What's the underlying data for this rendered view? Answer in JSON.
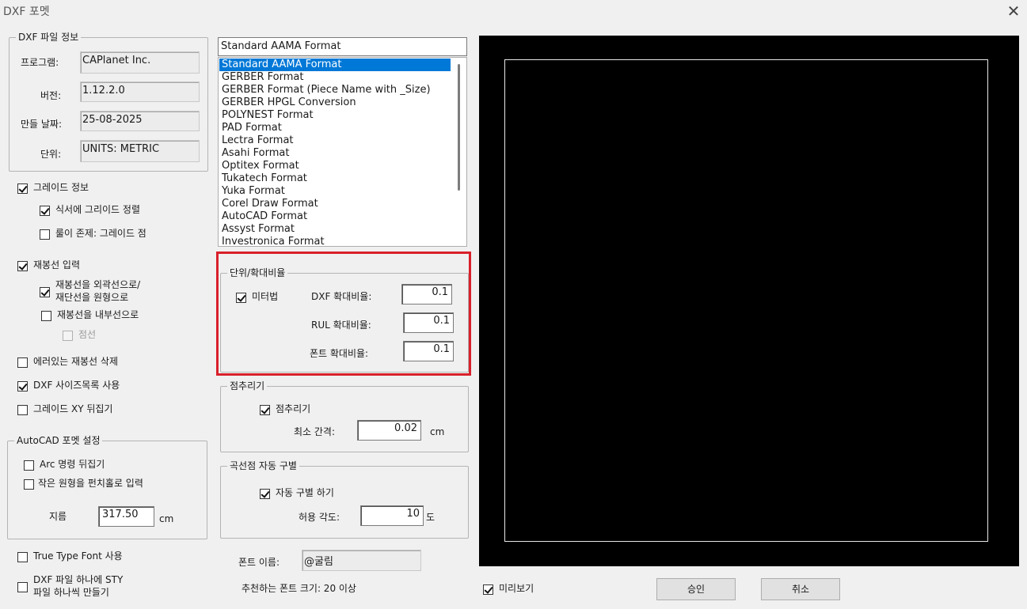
{
  "window": {
    "title": "DXF 포멧"
  },
  "file_info": {
    "legend": "DXF 파일 정보",
    "program_label": "프로그램:",
    "program_value": "CAPlanet Inc.",
    "version_label": "버전:",
    "version_value": "1.12.2.0",
    "date_label": "만들 날짜:",
    "date_value": "25-08-2025",
    "unit_label": "단위:",
    "unit_value": "UNITS: METRIC"
  },
  "options": {
    "grade_info": "그레이드 정보",
    "align_grade": "식서에 그리이드 정렬",
    "rule_exists": "룰이 존제: 그레이드 점",
    "seam_input": "재봉선 입력",
    "seam_outer_line1": "재봉선을 외곽선으로/",
    "seam_outer_line2": "재단선을 원형으로",
    "seam_inner": "재봉선을 내부선으로",
    "dotted": "점선",
    "delete_error_seam": "에러있는 재봉선 삭제",
    "use_size_list": "DXF 사이즈목록 사용",
    "flip_grade_xy": "그레이드 XY 뒤집기"
  },
  "autocad": {
    "legend": "AutoCAD 포멧 설정",
    "arc_flip": "Arc 명령 뒤집기",
    "small_circle": "작은 원형을 펀치홀로 입력",
    "diameter_label": "지름",
    "diameter_value": "317.50",
    "diameter_unit": "cm"
  },
  "font_options": {
    "use_truetype": "True Type Font 사용",
    "sty_line1": "DXF 파일 하나에 STY",
    "sty_line2": "파일 하나씩 만들기"
  },
  "format": {
    "selected": "Standard AAMA Format",
    "items": [
      "Standard AAMA Format",
      "GERBER Format",
      "GERBER Format (Piece Name with _Size)",
      "GERBER HPGL Conversion",
      "POLYNEST Format",
      "PAD Format",
      "Lectra Format",
      "Asahi Format",
      "Optitex Format",
      "Tukatech Format",
      "Yuka Format",
      "Corel Draw Format",
      "AutoCAD Format",
      "Assyst Format",
      "Investronica Format"
    ]
  },
  "scale": {
    "legend": "단위/확대비율",
    "meter": "미터법",
    "dxf_label": "DXF 확대비율:",
    "dxf_value": "0.1",
    "rul_label": "RUL 확대비율:",
    "rul_value": "0.1",
    "font_label": "폰트 확대비율:",
    "font_value": "0.1"
  },
  "point_reduction": {
    "legend": "점추리기",
    "checkbox": "점추리기",
    "min_gap_label": "최소 간격:",
    "min_gap_value": "0.02",
    "unit": "cm"
  },
  "curve_auto": {
    "legend": "곡선점 자동 구별",
    "checkbox": "자동 구별 하기",
    "angle_label": "허용 각도:",
    "angle_value": "10",
    "unit": "도"
  },
  "font": {
    "name_label": "폰트 이름:",
    "name_value": "@굴림",
    "recommend": "추천하는 폰트 크기: 20 이상"
  },
  "footer": {
    "preview": "미리보기",
    "ok": "승인",
    "cancel": "취소"
  },
  "icons": {
    "close": "close-icon"
  }
}
